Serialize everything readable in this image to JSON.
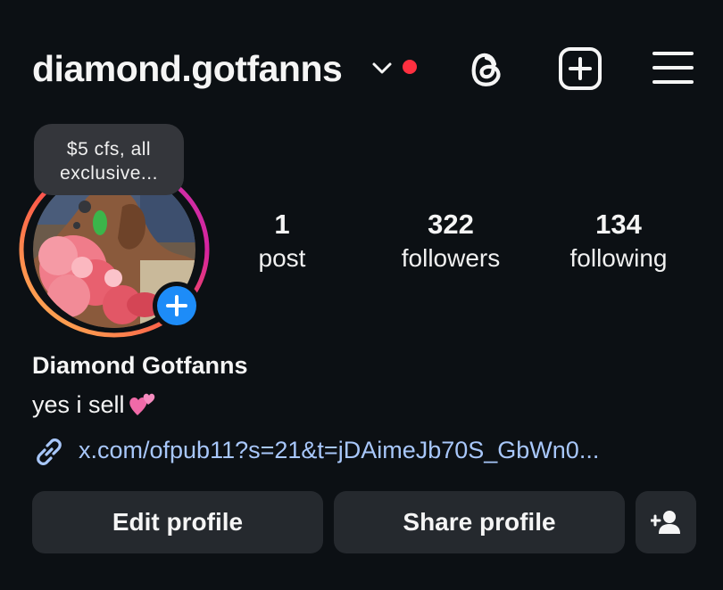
{
  "header": {
    "username": "diamond.gotfanns",
    "colors": {
      "notif_dot": "#ff3040",
      "text": "#f5f5f5"
    },
    "icons": [
      "chevron-down-icon",
      "threads-icon",
      "add-post-icon",
      "hamburger-menu-icon"
    ]
  },
  "note": {
    "line1": "$5 cfs, all",
    "line2": "exclusive..."
  },
  "stats": {
    "posts": {
      "value": "1",
      "label": "post"
    },
    "followers": {
      "value": "322",
      "label": "followers"
    },
    "following": {
      "value": "134",
      "label": "following"
    }
  },
  "profile": {
    "display_name": "Diamond Gotfanns",
    "bio": "yes i sell",
    "bio_emoji": "two-hearts-icon",
    "link": "x.com/ofpub11?s=21&t=jDAimeJb70S_GbWn0..."
  },
  "actions": {
    "edit_profile": "Edit profile",
    "share_profile": "Share profile",
    "add_user_icon": "add-person-icon"
  },
  "colors": {
    "background": "#0c1014",
    "button_bg": "#25292e",
    "link": "#a8c7fa",
    "add_badge": "#1d8cf8",
    "ring_gradient": [
      "#fec053",
      "#fd5949",
      "#d6249f",
      "#c837ab"
    ]
  }
}
